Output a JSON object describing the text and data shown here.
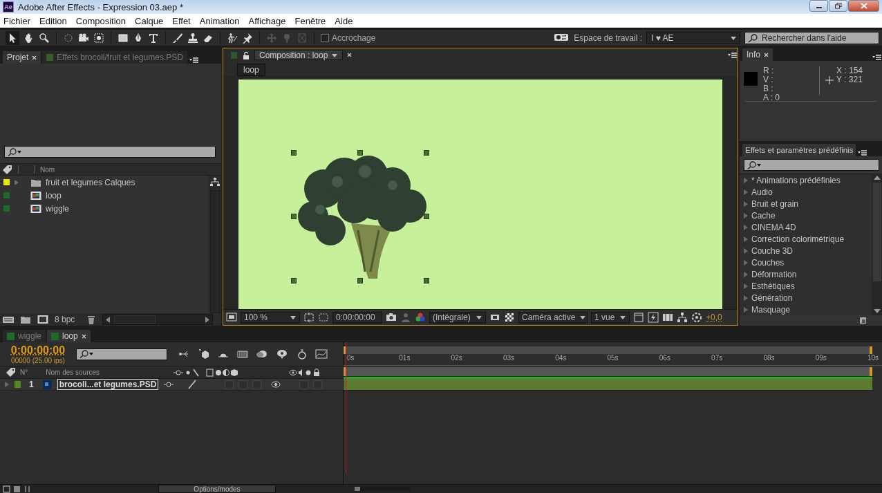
{
  "window": {
    "app_icon": "Ae",
    "title": "Adobe After Effects - Expression 03.aep *"
  },
  "menu": [
    "Fichier",
    "Edition",
    "Composition",
    "Calque",
    "Effet",
    "Animation",
    "Affichage",
    "Fenêtre",
    "Aide"
  ],
  "toolbar": {
    "snapping": {
      "label": "Accrochage",
      "checked": false
    },
    "workspace": {
      "label": "Espace de travail :",
      "value": "I ♥ AE"
    },
    "help_search": {
      "placeholder": "Rechercher dans l'aide"
    }
  },
  "project_panel": {
    "tabs": [
      {
        "label": "Projet",
        "selected": true
      },
      {
        "label": "Effets brocoli/fruit et legumes.PSD",
        "selected": false
      }
    ],
    "column": "Nom",
    "items": [
      {
        "name": "fruit et legumes Calques",
        "kind": "folder",
        "color": "#e8e800",
        "expanded": false
      },
      {
        "name": "loop",
        "kind": "composition",
        "color": "#1d6b2c"
      },
      {
        "name": "wiggle",
        "kind": "composition",
        "color": "#1d6b2c"
      }
    ],
    "bit_depth": "8 bpc"
  },
  "composition_panel": {
    "tab": "Composition : loop",
    "breadcrumb": "loop",
    "magnification": "100 %",
    "timecode": "0:00:00:00",
    "resolution": "(Intégrale)",
    "camera": "Caméra active",
    "views": "1 vue",
    "exposure": "+0,0"
  },
  "info_panel": {
    "tab": "Info",
    "readouts": [
      "R :",
      "V :",
      "B :",
      "A : 0"
    ],
    "coordinates": [
      "X : 154",
      "Y : 321"
    ]
  },
  "effects_panel": {
    "title": "Effets et paramètres prédéfinis",
    "categories": [
      {
        "label": "* Animations prédéfinies",
        "expanded": false
      },
      {
        "label": "Audio",
        "expanded": false
      },
      {
        "label": "Bruit et grain",
        "expanded": false
      },
      {
        "label": "Cache",
        "expanded": false
      },
      {
        "label": "CINEMA 4D",
        "expanded": false
      },
      {
        "label": "Correction colorimétrique",
        "expanded": false
      },
      {
        "label": "Couche 3D",
        "expanded": false
      },
      {
        "label": "Couches",
        "expanded": false
      },
      {
        "label": "Déformation",
        "expanded": false
      },
      {
        "label": "Esthétiques",
        "expanded": false
      },
      {
        "label": "Génération",
        "expanded": false
      },
      {
        "label": "Masquage",
        "expanded": false
      }
    ]
  },
  "timeline": {
    "tabs": [
      {
        "label": "wiggle",
        "selected": false
      },
      {
        "label": "loop",
        "selected": true
      }
    ],
    "timecode": "0:00:00:00",
    "frame_info": "00000 (25.00 ips)",
    "columns": {
      "number": "N°",
      "source_name": "Nom des sources"
    },
    "ruler": [
      "0s",
      "01s",
      "02s",
      "03s",
      "04s",
      "05s",
      "06s",
      "07s",
      "08s",
      "09s",
      "10s"
    ],
    "layers": [
      {
        "number": "1",
        "name": "brocoli...et legumes.PSD",
        "color": "#4f8a1e",
        "expanded": false
      }
    ],
    "mode_toggle": "Options/modes",
    "zoom_slider": {
      "level": 0.1
    }
  }
}
